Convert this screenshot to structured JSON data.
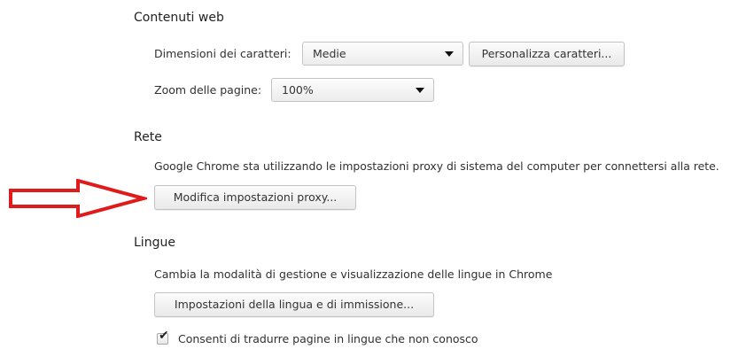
{
  "content_web": {
    "title": "Contenuti web",
    "font_size_label": "Dimensioni dei caratteri:",
    "font_size_value": "Medie",
    "customize_fonts_button": "Personalizza caratteri...",
    "zoom_label": "Zoom delle pagine:",
    "zoom_value": "100%"
  },
  "network": {
    "title": "Rete",
    "description": "Google Chrome sta utilizzando le impostazioni proxy di sistema del computer per connettersi alla rete.",
    "proxy_button": "Modifica impostazioni proxy..."
  },
  "languages": {
    "title": "Lingue",
    "description": "Cambia la modalità di gestione e visualizzazione delle lingue in Chrome",
    "language_button": "Impostazioni della lingua e di immissione...",
    "translate_checkbox_label": "Consenti di tradurre pagine in lingue che non conosco",
    "translate_checked": true
  },
  "annotation": {
    "arrow_color": "#e01b1b"
  },
  "icons": {
    "dropdown": "chevron-down-icon",
    "check": "check-icon",
    "arrow": "arrow-right-icon"
  }
}
